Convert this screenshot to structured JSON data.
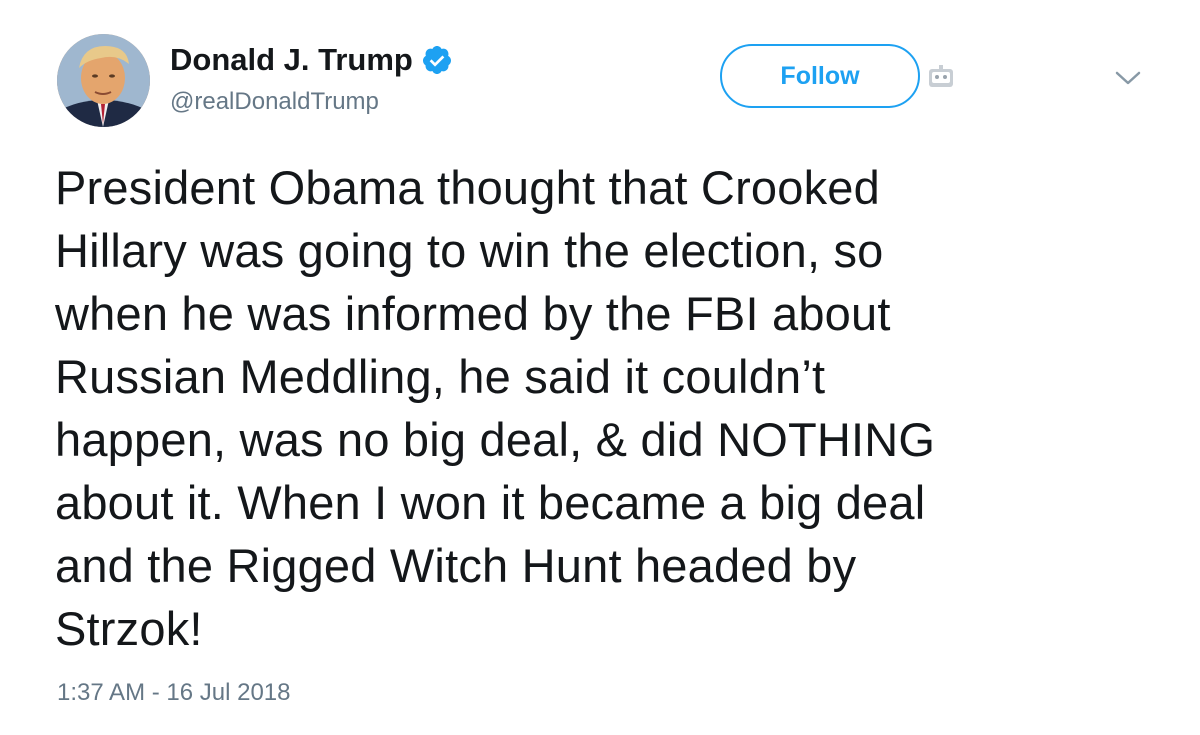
{
  "user": {
    "display_name": "Donald J. Trump",
    "handle": "@realDonaldTrump",
    "verified": true,
    "verified_icon": "verified-badge-icon"
  },
  "actions": {
    "follow_label": "Follow",
    "menu_icon": "chevron-down-icon"
  },
  "tweet": {
    "text": "President Obama thought that Crooked\nHillary was going to win the election, so\nwhen he was informed by the FBI about\nRussian Meddling, he said it couldn’t\nhappen, was no big deal, & did NOTHING\nabout it. When I won it became a big deal\nand the Rigged Witch Hunt headed by\nStrzok!",
    "timestamp": "1:37 AM - 16 Jul 2018"
  },
  "colors": {
    "accent": "#1da1f2",
    "text": "#14171a",
    "secondary_text": "#657786"
  }
}
